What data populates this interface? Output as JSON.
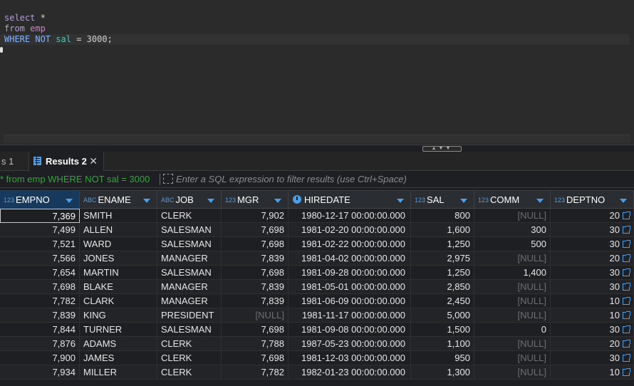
{
  "editor": {
    "line1": {
      "kw": "select",
      "rest": " *"
    },
    "line2": {
      "kw": "from",
      "table": "emp"
    },
    "line3": {
      "kw1": "WHERE",
      "kw2": "NOT",
      "col": "sal",
      "op": " = ",
      "val": "3000",
      "end": ";"
    }
  },
  "tabs": {
    "previous_label": "s 1",
    "results_label": "Results 2",
    "close_glyph": "✕"
  },
  "filter": {
    "history_text": "* from emp WHERE NOT sal = 3000",
    "placeholder": "Enter a SQL expression to filter results (use Ctrl+Space)"
  },
  "columns": [
    {
      "name": "EMPNO",
      "type_badge": "123"
    },
    {
      "name": "ENAME",
      "type_badge": "ABC"
    },
    {
      "name": "JOB",
      "type_badge": "ABC"
    },
    {
      "name": "MGR",
      "type_badge": "123"
    },
    {
      "name": "HIREDATE",
      "type_badge": "clock"
    },
    {
      "name": "SAL",
      "type_badge": "123"
    },
    {
      "name": "COMM",
      "type_badge": "123"
    },
    {
      "name": "DEPTNO",
      "type_badge": "123"
    }
  ],
  "rows": [
    [
      "7,369",
      "SMITH",
      "CLERK",
      "7,902",
      "1980-12-17 00:00:00.000",
      "800",
      "[NULL]",
      "20"
    ],
    [
      "7,499",
      "ALLEN",
      "SALESMAN",
      "7,698",
      "1981-02-20 00:00:00.000",
      "1,600",
      "300",
      "30"
    ],
    [
      "7,521",
      "WARD",
      "SALESMAN",
      "7,698",
      "1981-02-22 00:00:00.000",
      "1,250",
      "500",
      "30"
    ],
    [
      "7,566",
      "JONES",
      "MANAGER",
      "7,839",
      "1981-04-02 00:00:00.000",
      "2,975",
      "[NULL]",
      "20"
    ],
    [
      "7,654",
      "MARTIN",
      "SALESMAN",
      "7,698",
      "1981-09-28 00:00:00.000",
      "1,250",
      "1,400",
      "30"
    ],
    [
      "7,698",
      "BLAKE",
      "MANAGER",
      "7,839",
      "1981-05-01 00:00:00.000",
      "2,850",
      "[NULL]",
      "30"
    ],
    [
      "7,782",
      "CLARK",
      "MANAGER",
      "7,839",
      "1981-06-09 00:00:00.000",
      "2,450",
      "[NULL]",
      "10"
    ],
    [
      "7,839",
      "KING",
      "PRESIDENT",
      "[NULL]",
      "1981-11-17 00:00:00.000",
      "5,000",
      "[NULL]",
      "10"
    ],
    [
      "7,844",
      "TURNER",
      "SALESMAN",
      "7,698",
      "1981-09-08 00:00:00.000",
      "1,500",
      "0",
      "30"
    ],
    [
      "7,876",
      "ADAMS",
      "CLERK",
      "7,788",
      "1987-05-23 00:00:00.000",
      "1,100",
      "[NULL]",
      "20"
    ],
    [
      "7,900",
      "JAMES",
      "CLERK",
      "7,698",
      "1981-12-03 00:00:00.000",
      "950",
      "[NULL]",
      "30"
    ],
    [
      "7,934",
      "MILLER",
      "CLERK",
      "7,782",
      "1982-01-23 00:00:00.000",
      "1,300",
      "[NULL]",
      "10"
    ]
  ],
  "colors": {
    "accent": "#4a9fe8",
    "filter_history": "#2fa83a",
    "null_text": "#6e6e6e"
  }
}
